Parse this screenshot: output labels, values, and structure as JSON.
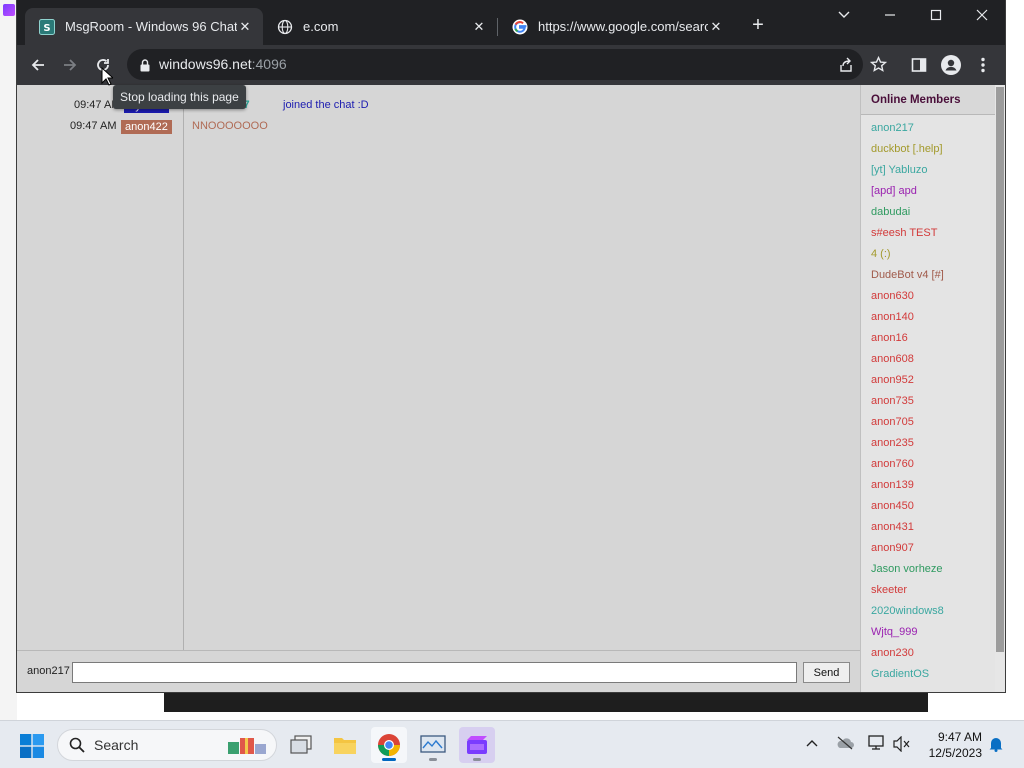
{
  "browser": {
    "tabs": [
      {
        "title": "MsgRoom - Windows 96 Chat",
        "favicon": "msgroom-icon",
        "active": true
      },
      {
        "title": "e.com",
        "favicon": "globe-icon",
        "active": false
      },
      {
        "title": "https://www.google.com/search",
        "favicon": "google-icon",
        "active": false
      }
    ],
    "url_host": "windows96.net",
    "url_port": ":4096",
    "reload_tooltip": "Stop loading this page"
  },
  "chat": {
    "messages": [
      {
        "time": "09:47 AM",
        "nick": "System",
        "nick_color": "#1c1cb0",
        "name": "anon217",
        "name_color": "#2aa89a",
        "text": "joined the chat :D",
        "text_color": "#1c1cb0"
      },
      {
        "time": "09:47 AM",
        "nick": "anon422",
        "nick_color": "#b06b55",
        "text": "NNOOOOOOO",
        "text_color": "#b06b55"
      }
    ],
    "input_nick": "anon217",
    "input_value": "",
    "send_label": "Send"
  },
  "members": {
    "title": "Online Members",
    "list": [
      {
        "name": "anon217",
        "color": "#3aa7a0"
      },
      {
        "name": "duckbot [.help]",
        "color": "#a39a2c"
      },
      {
        "name": "[yt] Yabluzo",
        "color": "#3aa7a0"
      },
      {
        "name": "[apd] apd",
        "color": "#9a22b0"
      },
      {
        "name": "dabudai",
        "color": "#2f9a60"
      },
      {
        "name": "s#eesh TEST",
        "color": "#d23a3a"
      },
      {
        "name": "4 (:)",
        "color": "#a39a2c"
      },
      {
        "name": "DudeBot v4 [#]",
        "color": "#a05a4a"
      },
      {
        "name": "anon630",
        "color": "#d23a3a"
      },
      {
        "name": "anon140",
        "color": "#d23a3a"
      },
      {
        "name": "anon16",
        "color": "#d23a3a"
      },
      {
        "name": "anon608",
        "color": "#d23a3a"
      },
      {
        "name": "anon952",
        "color": "#d23a3a"
      },
      {
        "name": "anon735",
        "color": "#d23a3a"
      },
      {
        "name": "anon705",
        "color": "#d23a3a"
      },
      {
        "name": "anon235",
        "color": "#d23a3a"
      },
      {
        "name": "anon760",
        "color": "#d23a3a"
      },
      {
        "name": "anon139",
        "color": "#d23a3a"
      },
      {
        "name": "anon450",
        "color": "#d23a3a"
      },
      {
        "name": "anon431",
        "color": "#d23a3a"
      },
      {
        "name": "anon907",
        "color": "#d23a3a"
      },
      {
        "name": "Jason vorheze",
        "color": "#2f9a60"
      },
      {
        "name": "skeeter",
        "color": "#d23a3a"
      },
      {
        "name": "2020windows8",
        "color": "#3aa7a0"
      },
      {
        "name": "Wjtq_999",
        "color": "#9a22b0"
      },
      {
        "name": "anon230",
        "color": "#d23a3a"
      },
      {
        "name": "GradientOS",
        "color": "#3aa7a0"
      }
    ]
  },
  "taskbar": {
    "search_label": "Search",
    "time": "9:47 AM",
    "date": "12/5/2023"
  }
}
